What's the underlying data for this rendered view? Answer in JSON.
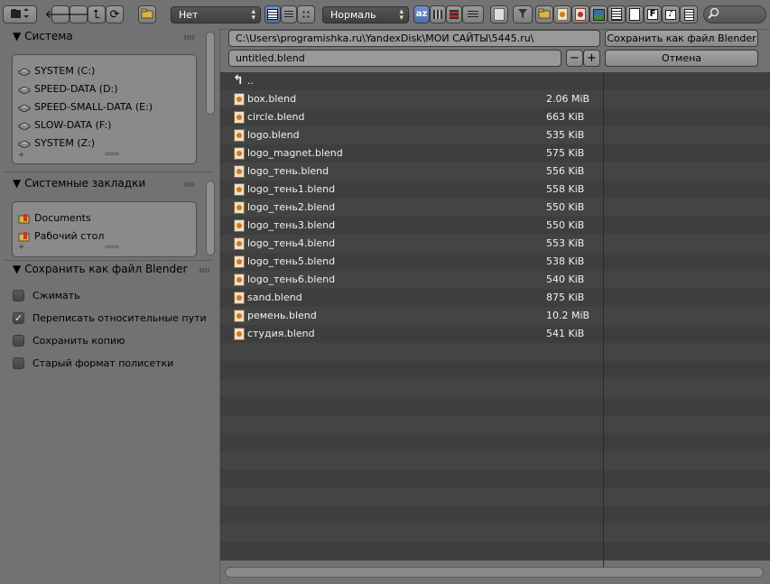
{
  "header": {
    "display_select": "Нет",
    "sort_select": "Нормаль",
    "icons": [
      "editor-type-icon",
      "back-icon",
      "forward-icon",
      "parent-dir-icon",
      "refresh-icon",
      "new-folder-icon",
      "thumbnails-icon",
      "list-icon",
      "grid-icon",
      "sort-alpha-icon",
      "sort-ext-icon",
      "sort-time-icon",
      "sort-size-icon",
      "hidden-icon",
      "filter-icon",
      "folder-filter-icon",
      "blend-filter-icon",
      "image-filter-icon",
      "movie-filter-icon",
      "script-filter-icon",
      "font-filter-icon",
      "sound-filter-icon",
      "text-filter-icon",
      "search-icon"
    ]
  },
  "sidebar": {
    "system_title": "Система",
    "drives": [
      "SYSTEM (C:)",
      "SPEED-DATA (D:)",
      "SPEED-SMALL-DATA (E:)",
      "SLOW-DATA (F:)",
      "SYSTEM (Z:)"
    ],
    "bookmarks_title": "Системные закладки",
    "bookmarks": [
      "Documents",
      "Рабочий стол"
    ],
    "save_title": "Сохранить как файл Blender",
    "options": [
      {
        "label": "Сжимать",
        "checked": false
      },
      {
        "label": "Переписать относительные пути",
        "checked": true
      },
      {
        "label": "Сохранить копию",
        "checked": false
      },
      {
        "label": "Старый формат полисетки",
        "checked": false
      }
    ]
  },
  "main": {
    "path": "C:\\Users\\programishka.ru\\YandexDisk\\МОИ САЙТЫ\\5445.ru\\",
    "filename": "untitled.blend",
    "save_button": "Сохранить как файл Blender",
    "cancel_button": "Отмена",
    "minus": "−",
    "plus": "+",
    "parent_label": "..",
    "files": [
      {
        "name": "box.blend",
        "size": "2.06 MiB"
      },
      {
        "name": "circle.blend",
        "size": "663 KiB"
      },
      {
        "name": "logo.blend",
        "size": "535 KiB"
      },
      {
        "name": "logo_magnet.blend",
        "size": "575 KiB"
      },
      {
        "name": "logo_тень.blend",
        "size": "556 KiB"
      },
      {
        "name": "logo_тень1.blend",
        "size": "558 KiB"
      },
      {
        "name": "logo_тень2.blend",
        "size": "550 KiB"
      },
      {
        "name": "logo_тень3.blend",
        "size": "550 KiB"
      },
      {
        "name": "logo_тень4.blend",
        "size": "553 KiB"
      },
      {
        "name": "logo_тень5.blend",
        "size": "538 KiB"
      },
      {
        "name": "logo_тень6.blend",
        "size": "540 KiB"
      },
      {
        "name": "sand.blend",
        "size": "875 KiB"
      },
      {
        "name": "ремень.blend",
        "size": "10.2 MiB"
      },
      {
        "name": "студия.blend",
        "size": "541 KiB"
      }
    ]
  }
}
